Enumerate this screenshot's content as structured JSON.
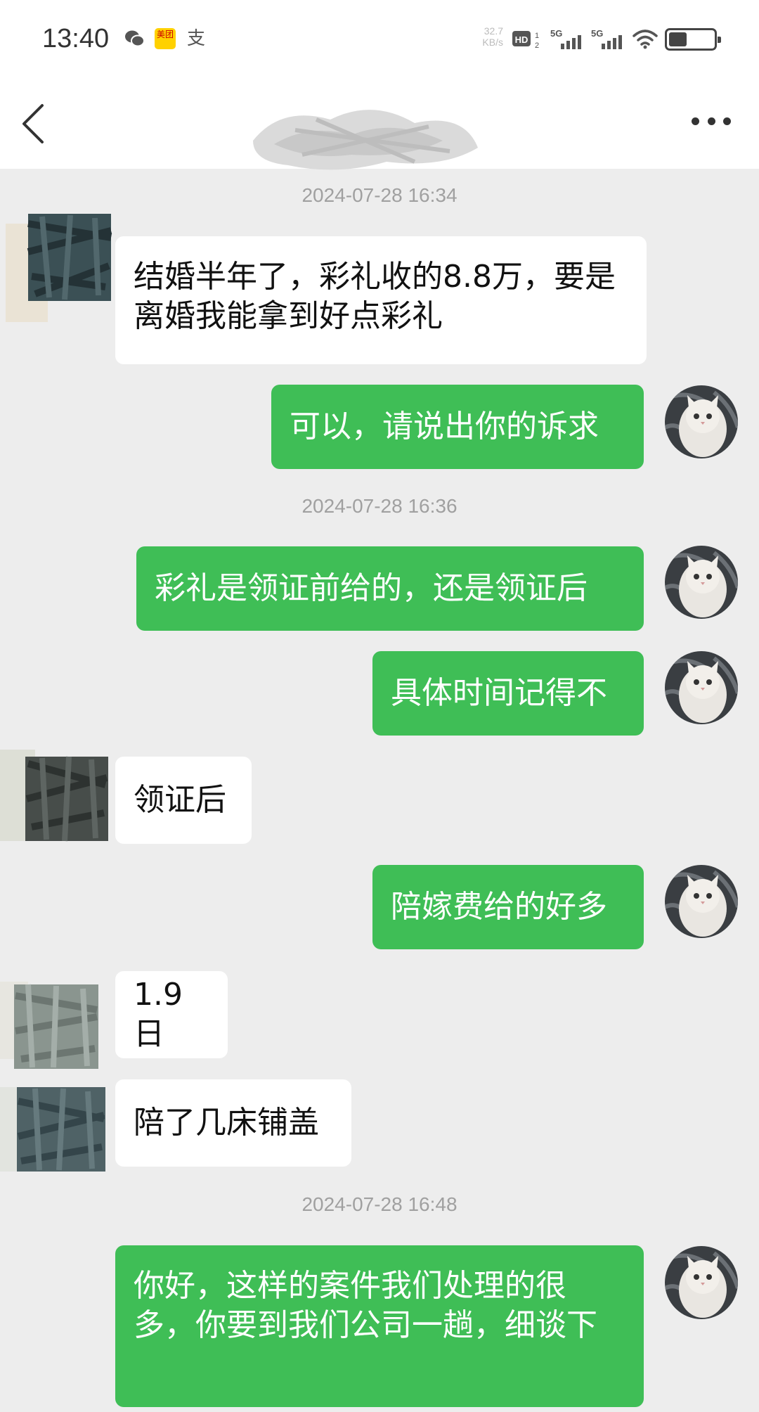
{
  "status_bar": {
    "time": "13:40",
    "meituan_label": "美团",
    "alipay_label": "支",
    "net_speed_value": "32.7",
    "net_speed_unit": "KB/s",
    "hd_label": "HD",
    "hd_sub": "1 2",
    "sim1_label": "5G",
    "sim2_label": "5G",
    "battery_level": 0.4
  },
  "header": {
    "back_icon": "chevron-left-icon",
    "more_icon": "more-horizontal-icon"
  },
  "messages": [
    {
      "type": "timestamp",
      "text": "2024-07-28 16:34"
    },
    {
      "type": "received",
      "text": "结婚半年了，彩礼收的8.8万，要是离婚我能拿到好点彩礼"
    },
    {
      "type": "sent",
      "text": "可以，请说出你的诉求"
    },
    {
      "type": "timestamp",
      "text": "2024-07-28 16:36"
    },
    {
      "type": "sent",
      "text": "彩礼是领证前给的，还是领证后"
    },
    {
      "type": "sent",
      "text": "具体时间记得不"
    },
    {
      "type": "received",
      "text": "领证后"
    },
    {
      "type": "sent",
      "text": "陪嫁费给的好多"
    },
    {
      "type": "received",
      "text": "1.9日"
    },
    {
      "type": "received",
      "text": "陪了几床铺盖"
    },
    {
      "type": "timestamp",
      "text": "2024-07-28 16:48"
    },
    {
      "type": "sent",
      "text": "你好，这样的案件我们处理的很多，你要到我们公司一趟，细谈下"
    }
  ]
}
